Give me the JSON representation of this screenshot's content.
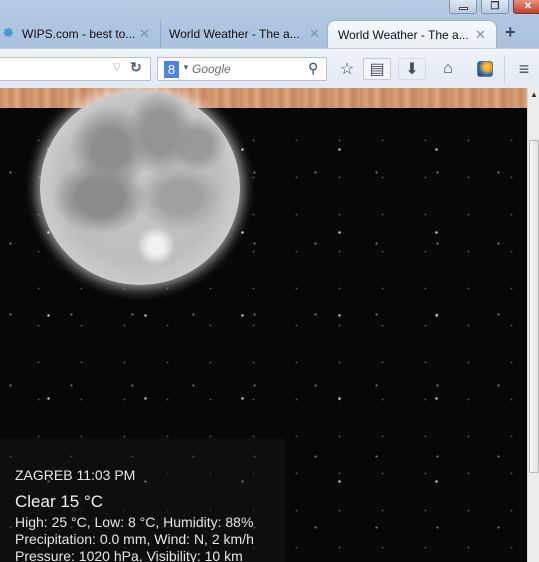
{
  "browser": {
    "tabs": [
      {
        "label": "WIPS.com - best to...",
        "icon": "gear-icon",
        "active": false
      },
      {
        "label": "World Weather - The a...",
        "active": false
      },
      {
        "label": "World Weather - The a...",
        "active": true
      }
    ],
    "new_tab": "+",
    "close_glyph": "✕",
    "window_controls": {
      "minimize": "minimize",
      "maximize": "restore",
      "close": "close"
    },
    "url": "",
    "search": {
      "engine": "8",
      "placeholder": "Google"
    },
    "toolbar_icons": [
      "star-icon",
      "reader-icon",
      "download-icon",
      "home-icon",
      "extension-icon",
      "menu-icon"
    ]
  },
  "weather": {
    "city_time": "ZAGREB 11:03 PM",
    "condition": "Clear 15 °C",
    "line1": "High: 25 °C, Low: 8 °C, Humidity: 88%",
    "line2": "Precipitation: 0.0 mm, Wind: N, 2 km/h",
    "line3": "Pressure: 1020 hPa, Visibility: 10 km"
  }
}
